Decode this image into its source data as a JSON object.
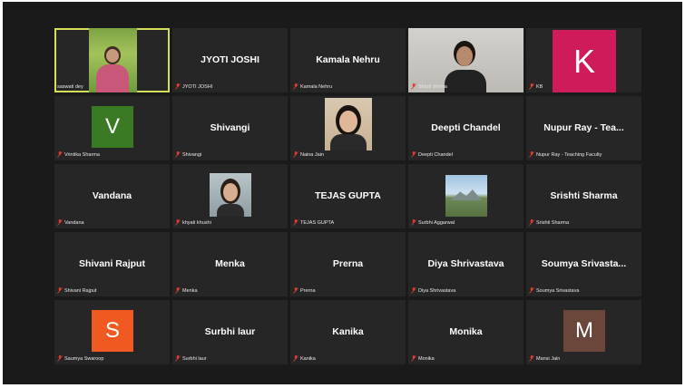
{
  "participants": [
    {
      "tile_name": "",
      "label": "saswati dey",
      "type": "video",
      "speaking": true
    },
    {
      "tile_name": "JYOTI JOSHI",
      "label": "JYOTI JOSHI",
      "type": "name"
    },
    {
      "tile_name": "Kamala Nehru",
      "label": "Kamala Nehru",
      "type": "name"
    },
    {
      "tile_name": "",
      "label": "Shruti Verma",
      "type": "video"
    },
    {
      "tile_name": "",
      "label": "KB",
      "type": "avatar",
      "initial": "K",
      "color": "#cf1a5c"
    },
    {
      "tile_name": "",
      "label": "Vrintika Sharma",
      "type": "avatar",
      "initial": "V",
      "color": "#3b7a24"
    },
    {
      "tile_name": "Shivangi",
      "label": "Shivangi",
      "type": "name"
    },
    {
      "tile_name": "",
      "label": "Naina Jain",
      "type": "picture"
    },
    {
      "tile_name": "Deepti Chandel",
      "label": "Deepti Chandel",
      "type": "name"
    },
    {
      "tile_name": "Nupur Ray - Tea...",
      "label": "Nupur Ray - Teaching Faculty",
      "type": "name"
    },
    {
      "tile_name": "Vandana",
      "label": "Vandana",
      "type": "name"
    },
    {
      "tile_name": "",
      "label": "khyati khushi",
      "type": "picture"
    },
    {
      "tile_name": "TEJAS GUPTA",
      "label": "TEJAS GUPTA",
      "type": "name"
    },
    {
      "tile_name": "",
      "label": "Surbhi Aggarwal",
      "type": "picture"
    },
    {
      "tile_name": "Srishti Sharma",
      "label": "Srishti Sharma",
      "type": "name"
    },
    {
      "tile_name": "Shivani Rajput",
      "label": "Shivani Rajput",
      "type": "name"
    },
    {
      "tile_name": "Menka",
      "label": "Menka",
      "type": "name"
    },
    {
      "tile_name": "Prerna",
      "label": "Prerna",
      "type": "name"
    },
    {
      "tile_name": "Diya Shrivastava",
      "label": "Diya Shrivastava",
      "type": "name"
    },
    {
      "tile_name": "Soumya  Srivasta...",
      "label": "Soumya Srivastava",
      "type": "name"
    },
    {
      "tile_name": "",
      "label": "Saumya Swaroop",
      "type": "avatar",
      "initial": "S",
      "color": "#f05a22"
    },
    {
      "tile_name": "Surbhi laur",
      "label": "Surbhi laur",
      "type": "name"
    },
    {
      "tile_name": "Kanika",
      "label": "Kanika",
      "type": "name"
    },
    {
      "tile_name": "Monika",
      "label": "Monika",
      "type": "name"
    },
    {
      "tile_name": "",
      "label": "Mansi Jain",
      "type": "avatar",
      "initial": "M",
      "color": "#6b463b"
    }
  ],
  "colors": {
    "background": "#1a1a1a",
    "tile": "#262626",
    "active_speaker_border": "#d6df5b",
    "muted_mic": "#e03c31"
  },
  "icons": {
    "muted_mic": "microphone-muted-icon"
  }
}
